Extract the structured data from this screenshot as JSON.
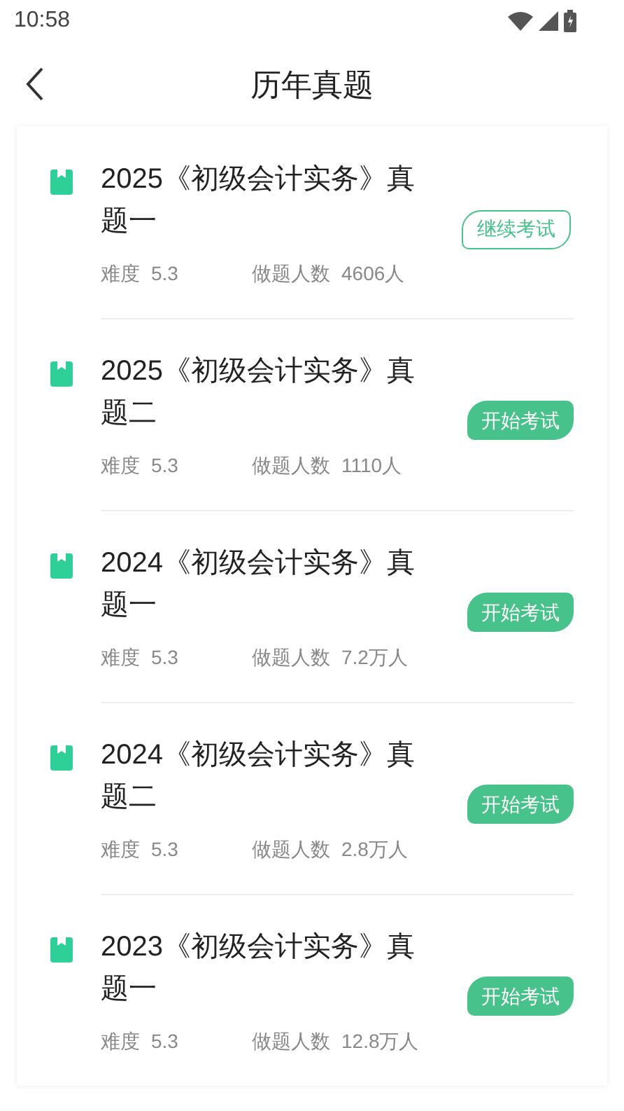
{
  "status_bar": {
    "time": "10:58"
  },
  "header": {
    "title": "历年真题"
  },
  "papers": [
    {
      "title": "2025《初级会计实务》真题一",
      "difficulty_label": "难度",
      "difficulty": "5.3",
      "takers_label": "做题人数",
      "takers": "4606人",
      "button": "继续考试",
      "in_progress": true
    },
    {
      "title": "2025《初级会计实务》真题二",
      "difficulty_label": "难度",
      "difficulty": "5.3",
      "takers_label": "做题人数",
      "takers": "1110人",
      "button": "开始考试",
      "in_progress": false
    },
    {
      "title": "2024《初级会计实务》真题一",
      "difficulty_label": "难度",
      "difficulty": "5.3",
      "takers_label": "做题人数",
      "takers": "7.2万人",
      "button": "开始考试",
      "in_progress": false
    },
    {
      "title": "2024《初级会计实务》真题二",
      "difficulty_label": "难度",
      "difficulty": "5.3",
      "takers_label": "做题人数",
      "takers": "2.8万人",
      "button": "开始考试",
      "in_progress": false
    },
    {
      "title": "2023《初级会计实务》真题一",
      "difficulty_label": "难度",
      "difficulty": "5.3",
      "takers_label": "做题人数",
      "takers": "12.8万人",
      "button": "开始考试",
      "in_progress": false
    }
  ]
}
